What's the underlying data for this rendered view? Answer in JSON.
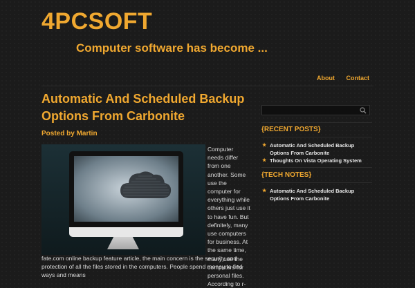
{
  "site": {
    "title": "4PCSOFT",
    "tagline": "Computer software has become ..."
  },
  "nav": {
    "items": [
      {
        "label": "About"
      },
      {
        "label": "Contact"
      }
    ]
  },
  "post": {
    "title": "Automatic And Scheduled Backup Options From Carbonite",
    "byline": "Posted by Martin",
    "image_icon": "cloud-icon",
    "body_narrow": "Computer needs differ from one another. Some use the computer for everything while others just use it to have fun. But definitely, many use computers for business. At the same time, many use the computers for personal files. According to r-",
    "body_wide": "fate.com online backup feature article, the main concern is the security and protection of all the files stored in the computers. People spend money to find ways and means"
  },
  "sidebar": {
    "search_placeholder": "",
    "recent_title": "{RECENT POSTS}",
    "recent_items": [
      {
        "label": "Automatic And Scheduled Backup Options From Carbonite"
      },
      {
        "label": "Thoughts On Vista Operating System"
      }
    ],
    "tech_title": "{TECH NOTES}",
    "tech_items": [
      {
        "label": "Automatic And Scheduled Backup Options From Carbonite"
      }
    ]
  },
  "colors": {
    "accent": "#f0a830",
    "background": "#1b1b1b",
    "text": "#d9d9d9"
  }
}
